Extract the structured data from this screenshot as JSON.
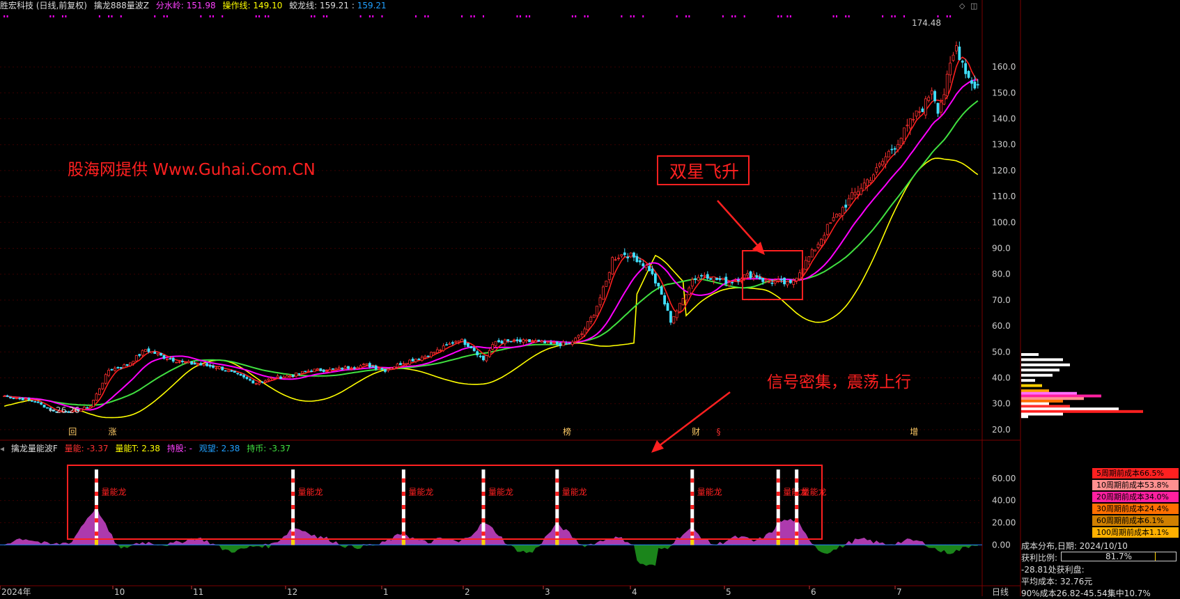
{
  "header": {
    "stock": "胜宏科技 (日线,前复权)",
    "indicator": "擒龙888量波Z",
    "fsl_label": "分水岭: ",
    "fsl_value": "151.98",
    "czx_label": "操作线: ",
    "czx_value": "149.10",
    "jlx_label": "蛟龙线: ",
    "jlx_value1": "159.21",
    "jlx_value2": "159.21"
  },
  "lower_header": {
    "indicator": "擒龙量能波F",
    "ln_label": "量能: ",
    "ln_value": "-3.37",
    "lnt_label": "量能T: ",
    "lnt_value": "2.38",
    "cg_label": "持股: ",
    "cg_value": "-",
    "gw_label": "观望: ",
    "gw_value": "2.38",
    "cb_label": "持币: ",
    "cb_value": "-3.37"
  },
  "annotations": {
    "watermark": "股海网提供 Www.Guhai.Com.CN",
    "double_star": "双星飞升",
    "signal_dense": "信号密集，震荡上行",
    "high_label": "174.48",
    "low_label": "←26.26"
  },
  "event_markers": [
    "回",
    "涨",
    "榜",
    "财",
    "§",
    "增"
  ],
  "energy_label": "量能龙",
  "colors": {
    "up": "#ff3030",
    "down": "#40e0ff",
    "fsl": "#ff00ff",
    "czx": "#ffff00",
    "jlx": "#00bfff",
    "green_line": "#40e040",
    "red_line": "#ff2020",
    "pos_area": "#c040c0",
    "neg_area": "#1c8c1c",
    "annot": "#ff2020"
  },
  "x_axis": {
    "labels": [
      "2024年",
      "10",
      "11",
      "12",
      "1",
      "2",
      "3",
      "4",
      "5",
      "6",
      "7"
    ],
    "period": "日线"
  },
  "cost_panel": {
    "legend": [
      {
        "label": "5周期前成本66.5%",
        "color": "#ff2020"
      },
      {
        "label": "10周期前成本53.8%",
        "color": "#ff9090"
      },
      {
        "label": "20周期前成本34.0%",
        "color": "#ff20a0"
      },
      {
        "label": "30周期前成本24.4%",
        "color": "#ff7000"
      },
      {
        "label": "60周期前成本6.1%",
        "color": "#d08000"
      },
      {
        "label": "100周期前成本1.1%",
        "color": "#ffb000"
      }
    ],
    "date_line": "成本分布,日期:  2024/10/10",
    "profit_label": "获利比例:",
    "profit_value": "81.7%",
    "profit_ratio": 0.817,
    "line3": "-28.81处获利盘:",
    "line4": "平均成本:  32.76元",
    "line5": "90%成本26.82-45.54集中10.7%"
  },
  "chart_data": [
    {
      "type": "candlestick",
      "title": "擒龙888量波Z",
      "y_axis_ticks": [
        20,
        30,
        40,
        50,
        60,
        70,
        80,
        90,
        100,
        110,
        120,
        130,
        140,
        150,
        160
      ],
      "ylim": [
        17,
        181
      ],
      "price_anchors": [
        [
          0,
          33
        ],
        [
          10,
          31
        ],
        [
          16,
          27
        ],
        [
          22,
          27
        ],
        [
          28,
          29
        ],
        [
          34,
          43
        ],
        [
          40,
          45
        ],
        [
          46,
          51
        ],
        [
          52,
          48
        ],
        [
          58,
          46
        ],
        [
          64,
          45
        ],
        [
          70,
          44
        ],
        [
          76,
          41
        ],
        [
          82,
          38
        ],
        [
          88,
          40
        ],
        [
          94,
          41
        ],
        [
          100,
          43
        ],
        [
          106,
          43
        ],
        [
          112,
          44
        ],
        [
          118,
          45
        ],
        [
          124,
          43
        ],
        [
          130,
          46
        ],
        [
          136,
          48
        ],
        [
          142,
          51
        ],
        [
          148,
          55
        ],
        [
          152,
          52
        ],
        [
          156,
          47
        ],
        [
          160,
          54
        ],
        [
          166,
          54
        ],
        [
          172,
          54
        ],
        [
          178,
          53
        ],
        [
          184,
          53
        ],
        [
          188,
          57
        ],
        [
          192,
          65
        ],
        [
          196,
          77
        ],
        [
          198,
          86
        ],
        [
          202,
          88
        ],
        [
          206,
          86
        ],
        [
          210,
          82
        ],
        [
          214,
          72
        ],
        [
          217,
          62
        ],
        [
          220,
          68
        ],
        [
          224,
          78
        ],
        [
          228,
          80
        ],
        [
          232,
          78
        ],
        [
          236,
          77
        ],
        [
          240,
          79
        ],
        [
          244,
          80
        ],
        [
          248,
          77
        ],
        [
          252,
          77
        ],
        [
          256,
          76
        ],
        [
          260,
          83
        ],
        [
          264,
          90
        ],
        [
          268,
          98
        ],
        [
          272,
          104
        ],
        [
          276,
          110
        ],
        [
          280,
          115
        ],
        [
          284,
          120
        ],
        [
          288,
          127
        ],
        [
          292,
          133
        ],
        [
          296,
          140
        ],
        [
          300,
          146
        ],
        [
          302,
          152
        ],
        [
          304,
          144
        ],
        [
          306,
          150
        ],
        [
          308,
          160
        ],
        [
          310,
          168
        ],
        [
          312,
          162
        ],
        [
          314,
          156
        ],
        [
          316,
          153
        ]
      ],
      "lines": [
        {
          "name": "分水岭",
          "value": 151.98
        },
        {
          "name": "操作线",
          "value": 149.1
        },
        {
          "name": "蛟龙线",
          "value": 159.21
        }
      ],
      "high": 174.48,
      "low": 26.26
    },
    {
      "type": "area",
      "title": "擒龙量能波F",
      "y_axis_ticks": [
        0,
        20,
        40,
        60
      ],
      "ylim": [
        -35,
        80
      ],
      "signal_positions": [
        30,
        94,
        130,
        156,
        180,
        224,
        252,
        258
      ],
      "series": [
        {
          "name": "量能",
          "value": -3.37
        },
        {
          "name": "量能T",
          "value": 2.38
        },
        {
          "name": "观望",
          "value": 2.38
        },
        {
          "name": "持币",
          "value": -3.37
        }
      ]
    }
  ]
}
